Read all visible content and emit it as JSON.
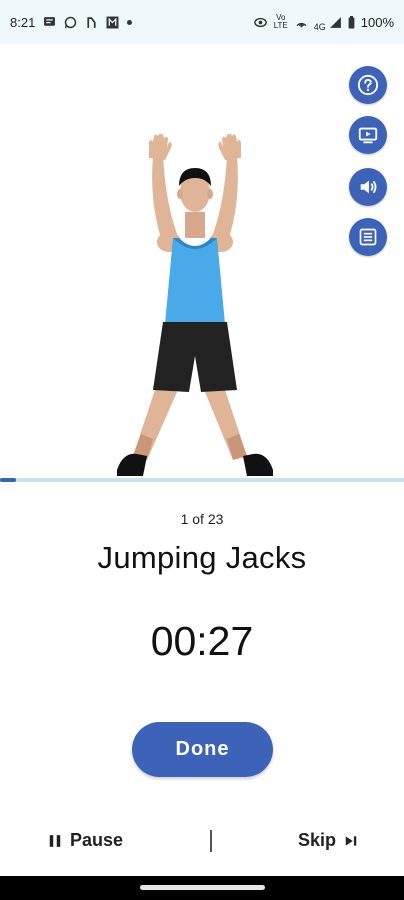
{
  "status_bar": {
    "time": "8:21",
    "left_icons": [
      "message-icon",
      "whatsapp-icon",
      "fitness-icon",
      "m-app-icon",
      "dot-icon"
    ],
    "right_icons": [
      "eye-icon",
      "volte-icon",
      "hotspot-icon",
      "4g-icon",
      "signal-icon",
      "battery-icon"
    ],
    "network_label": "4G",
    "volte_label": "Vo LTE",
    "battery": "100%"
  },
  "exercise": {
    "counter": "1 of 23",
    "name": "Jumping Jacks",
    "timer": "00:27",
    "progress": 0.04
  },
  "actions": {
    "help_icon": "help-icon",
    "video_icon": "video-icon",
    "sound_icon": "sound-icon",
    "list_icon": "list-icon",
    "done_label": "Done"
  },
  "bottom": {
    "pause_label": "Pause",
    "skip_label": "Skip"
  },
  "colors": {
    "accent": "#3d63b8",
    "progress_track": "#cfe0ef",
    "status_bar_bg": "#eef8fb"
  }
}
